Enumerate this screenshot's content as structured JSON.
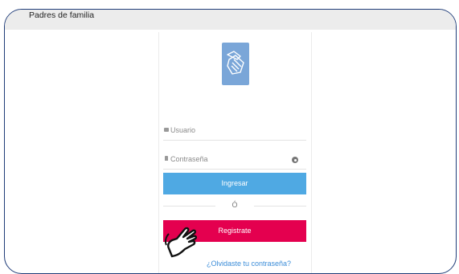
{
  "header": {
    "title": "Padres de familia"
  },
  "login": {
    "logo_icon": "hands-icon",
    "username_placeholder": "Usuario",
    "password_placeholder": "Contraseña",
    "login_label": "Ingresar",
    "or_label": "Ó",
    "register_label": "Registrate",
    "forgot_label": "¿Olvidaste tu contraseña?"
  },
  "cursor": {
    "icon": "hand-pointer-icon"
  },
  "colors": {
    "frame": "#1f3c78",
    "header_bg": "#ececec",
    "logo_bg": "#7aa6d8",
    "login_button": "#4fa9e3",
    "register_button": "#e4004f",
    "link": "#3a8cd8"
  }
}
